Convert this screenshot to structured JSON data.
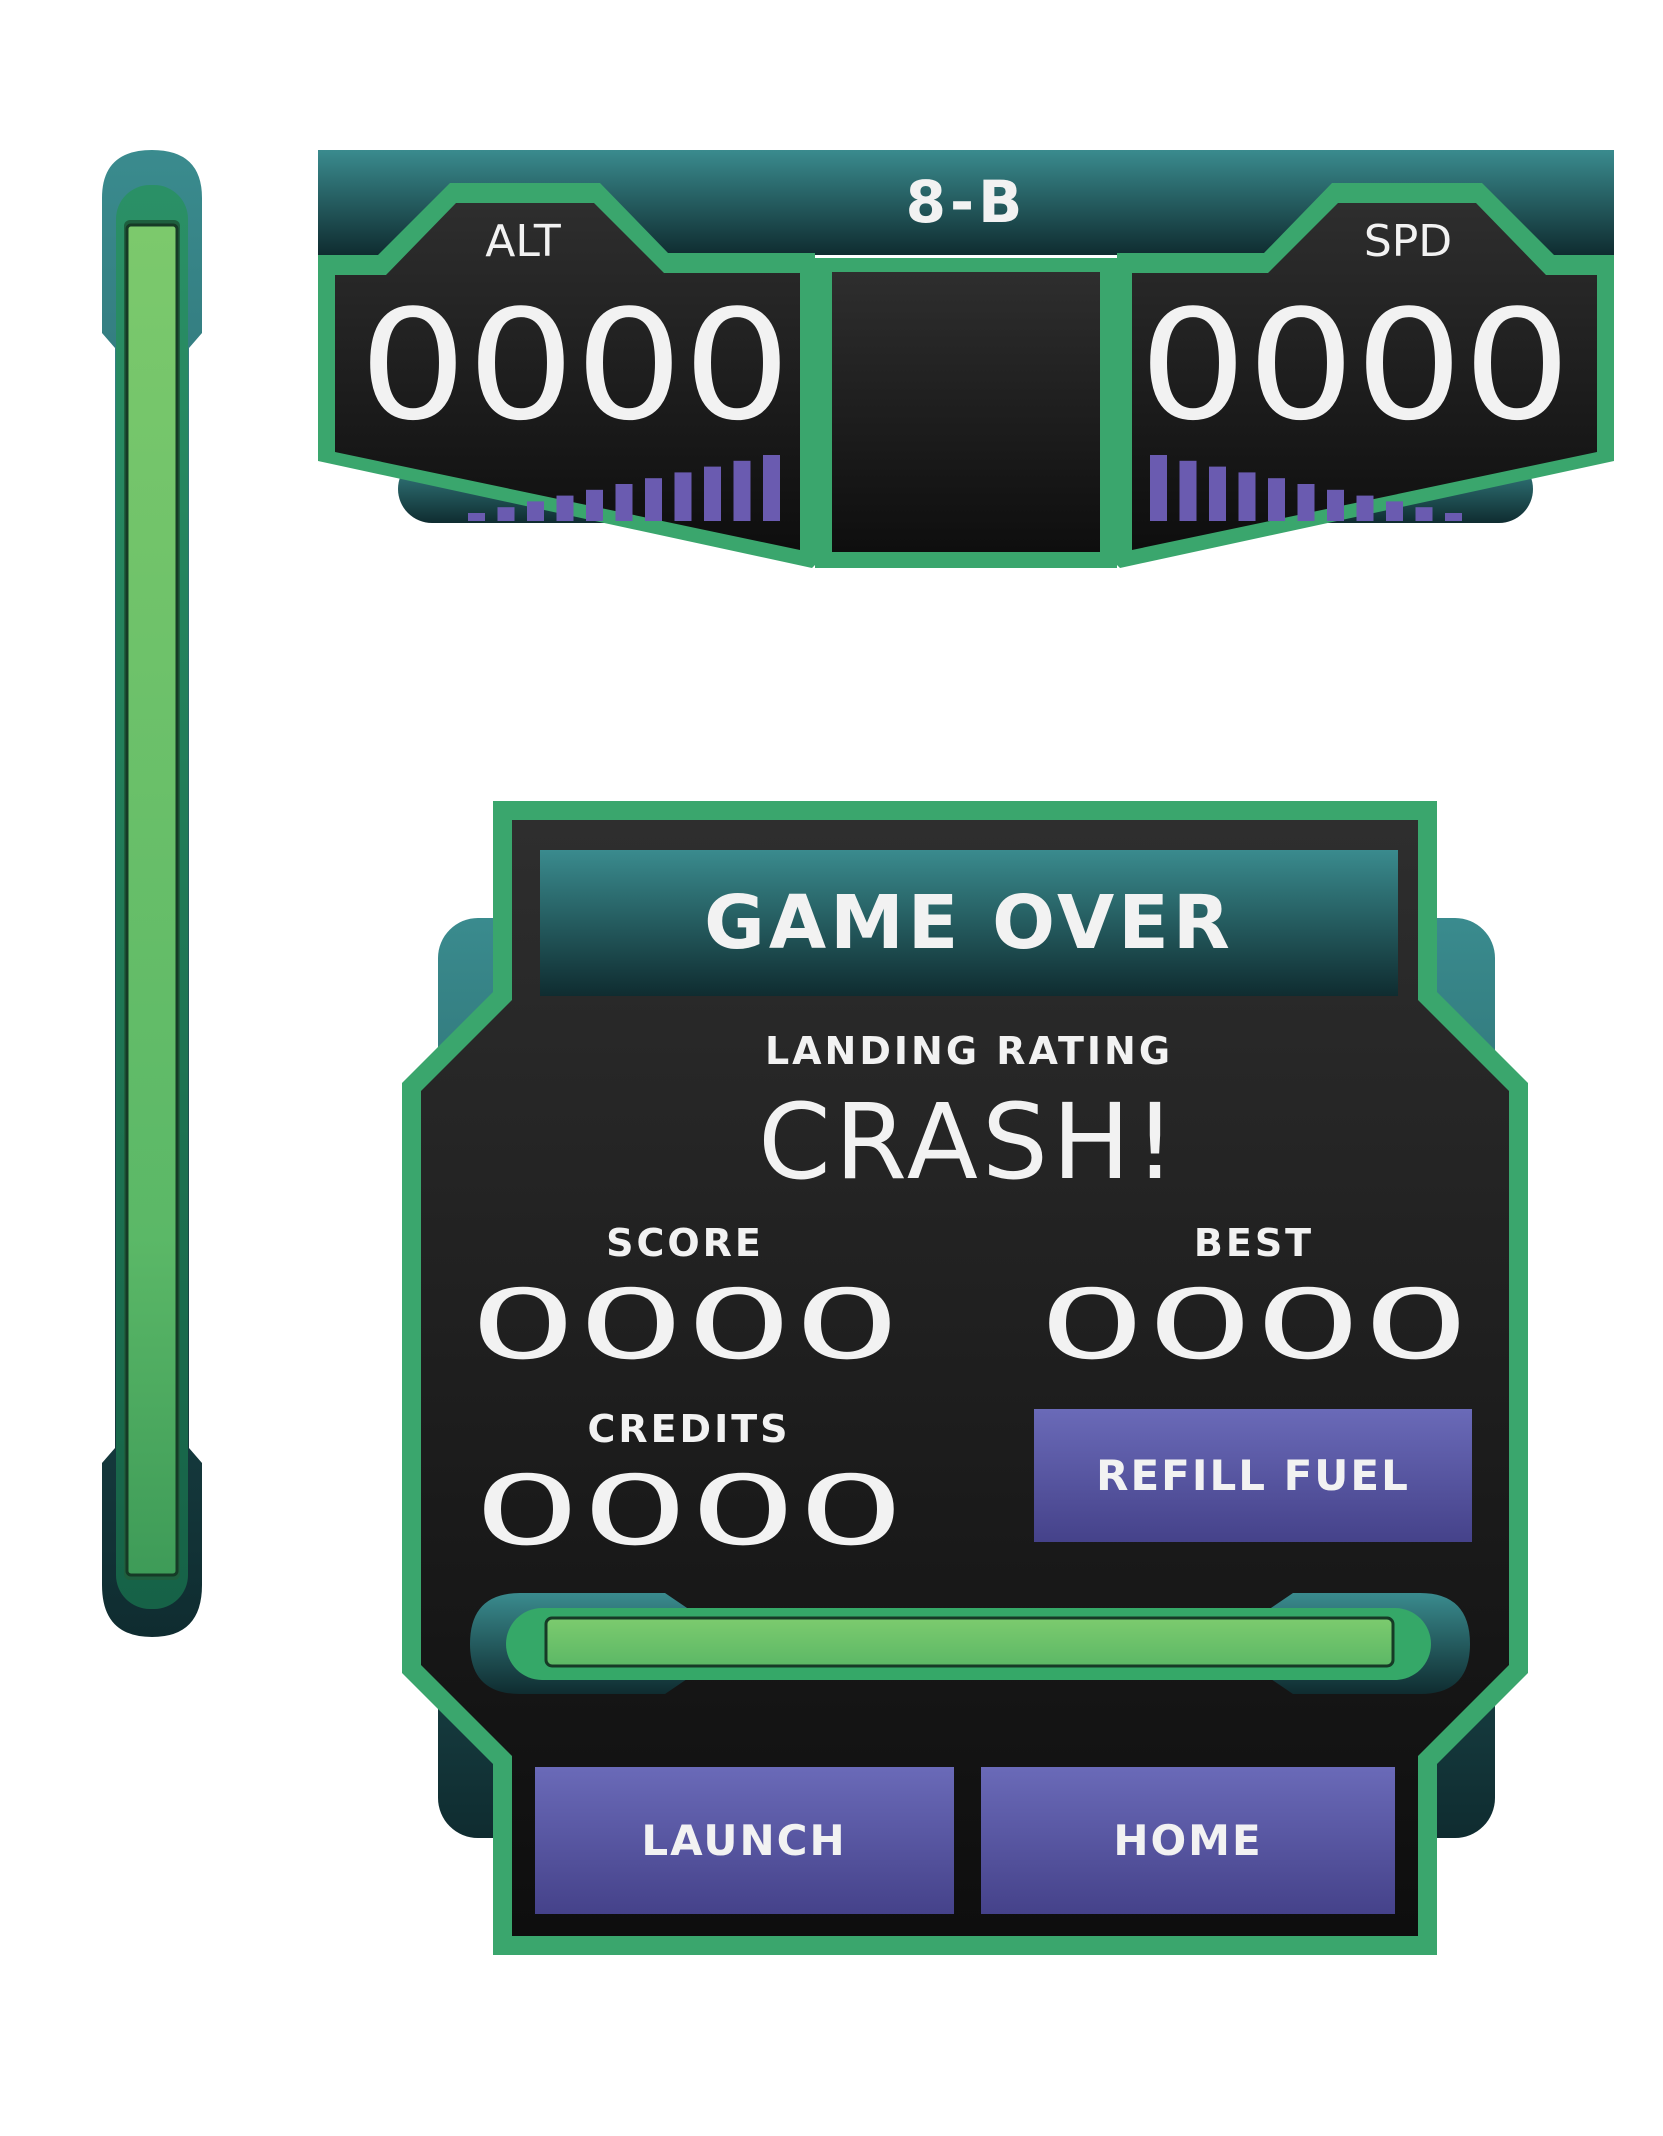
{
  "hud": {
    "level_label": "8-B",
    "altitude": {
      "label": "ALT",
      "value": "0000"
    },
    "speed": {
      "label": "SPD",
      "value": "0000"
    }
  },
  "side_fuel_gauge": {
    "fill_fraction": 1.0
  },
  "game_over": {
    "title": "GAME OVER",
    "rating_label": "LANDING RATING",
    "rating_value": "CRASH!",
    "score": {
      "label": "SCORE",
      "value": "0000"
    },
    "best": {
      "label": "BEST",
      "value": "0000"
    },
    "credits": {
      "label": "CREDITS",
      "value": "0000"
    },
    "refill_button": "REFILL FUEL",
    "fuel_bar": {
      "fill_fraction": 1.0
    },
    "launch_button": "LAUNCH",
    "home_button": "HOME"
  },
  "colors": {
    "teal_top": "#3a8b8e",
    "teal_bottom": "#0f2c30",
    "green_border": "#2e9b63",
    "green_fill": "#6cc068",
    "panel_dark": "#1c1c1c",
    "button_purple": "#5a5aa8",
    "tick_purple": "#6a5bb0"
  }
}
